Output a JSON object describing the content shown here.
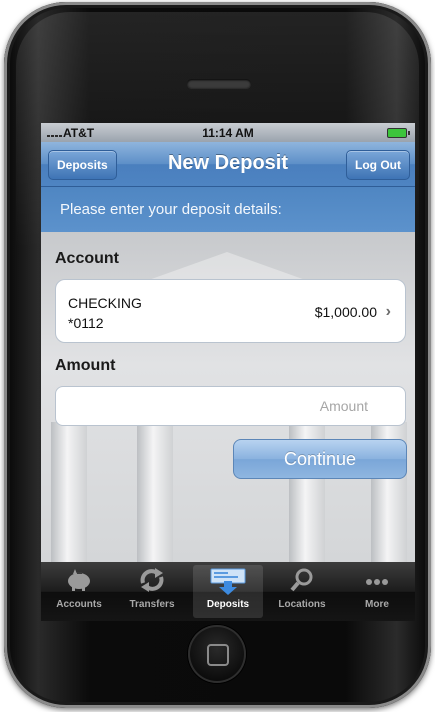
{
  "status_bar": {
    "carrier": "AT&T",
    "time": "11:14 AM"
  },
  "nav": {
    "back_label": "Deposits",
    "title": "New Deposit",
    "logout_label": "Log Out"
  },
  "prompt": "Please enter your deposit details:",
  "account_section": {
    "label": "Account",
    "account_name": "CHECKING",
    "account_number": "*0112",
    "balance": "$1,000.00",
    "chevron": "›"
  },
  "amount_section": {
    "label": "Amount",
    "placeholder": "Amount",
    "value": ""
  },
  "continue_label": "Continue",
  "tabs": [
    {
      "label": "Accounts",
      "icon": "piggy-bank-icon",
      "active": false
    },
    {
      "label": "Transfers",
      "icon": "transfer-arrows-icon",
      "active": false
    },
    {
      "label": "Deposits",
      "icon": "check-deposit-icon",
      "active": true
    },
    {
      "label": "Locations",
      "icon": "search-icon",
      "active": false
    },
    {
      "label": "More",
      "icon": "more-dots-icon",
      "active": false
    }
  ],
  "colors": {
    "nav_blue": "#4e84c2",
    "button_blue": "#8ab2df",
    "tab_bar": "#151515",
    "battery_green": "#3cc43c"
  }
}
